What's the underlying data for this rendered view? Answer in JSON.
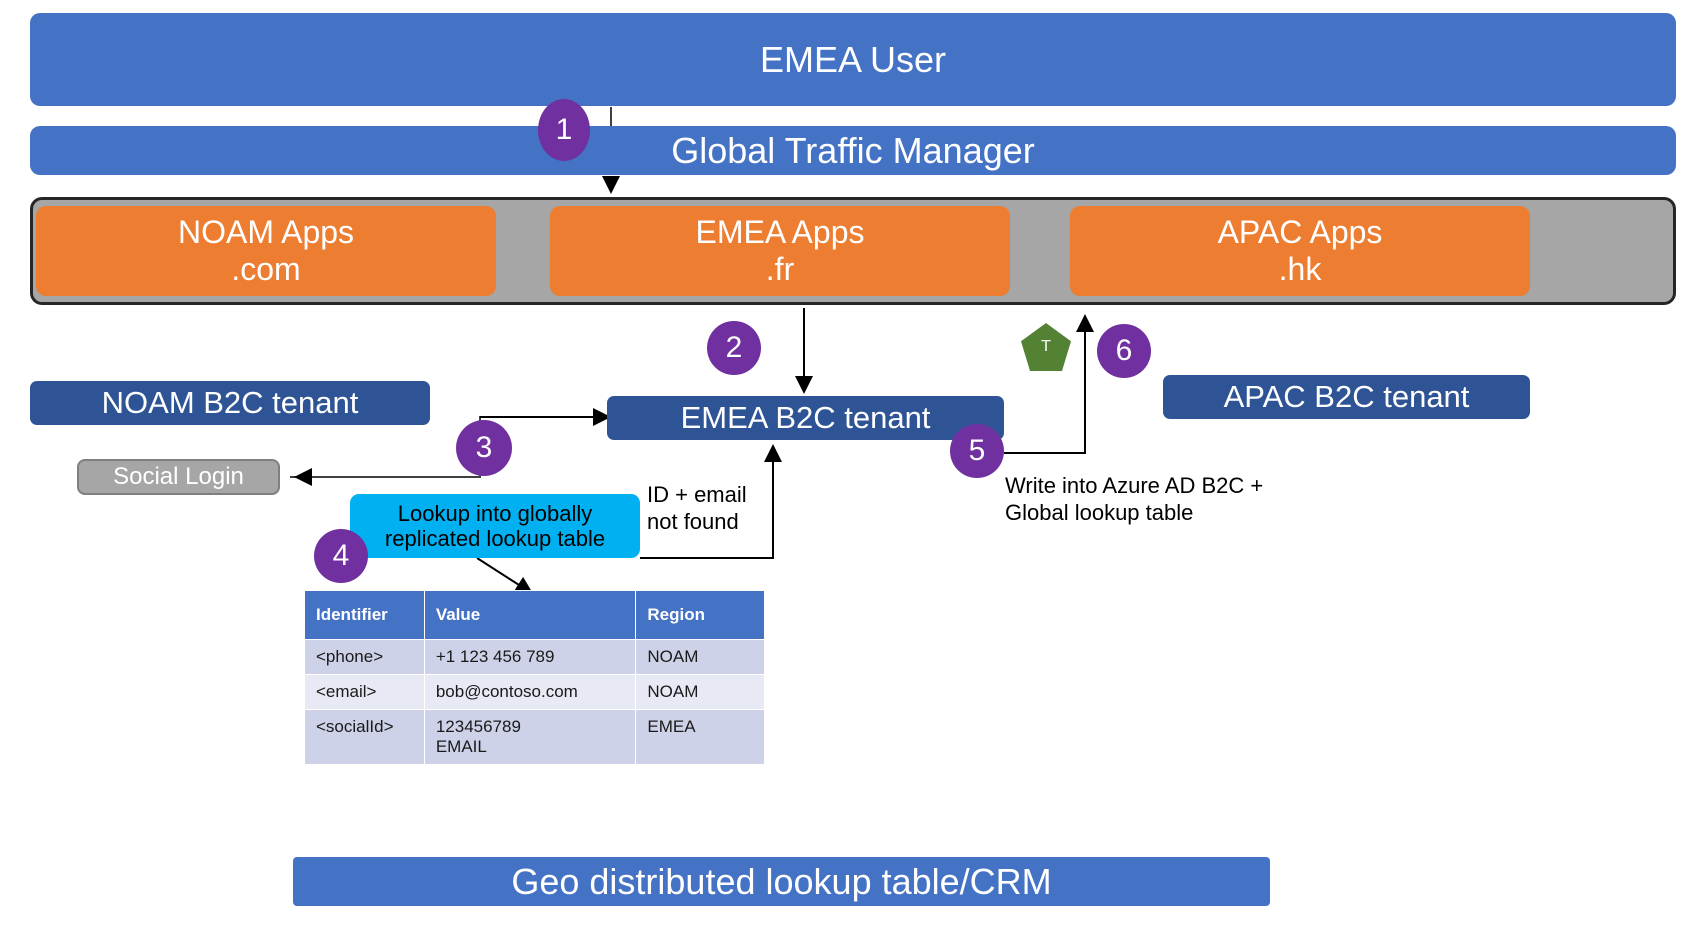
{
  "banners": {
    "emea_user": "EMEA User",
    "global_traffic_manager": "Global Traffic Manager",
    "crm": "Geo distributed lookup table/CRM"
  },
  "apps": [
    {
      "name": "NOAM Apps",
      "domain": ".com"
    },
    {
      "name": "EMEA Apps",
      "domain": ".fr"
    },
    {
      "name": "APAC Apps",
      "domain": ".hk"
    }
  ],
  "tenants": {
    "noam": "NOAM B2C tenant",
    "emea": "EMEA B2C tenant",
    "apac": "APAC B2C tenant"
  },
  "social_login": "Social Login",
  "lookup_callout": {
    "line1": "Lookup into globally",
    "line2": "replicated lookup table"
  },
  "annotations": {
    "not_found_line1": "ID + email",
    "not_found_line2": "not found",
    "write_line1": "Write into Azure AD B2C +",
    "write_line2": "Global lookup table"
  },
  "badges": {
    "one": "1",
    "two": "2",
    "three": "3",
    "four": "4",
    "five": "5",
    "six": "6"
  },
  "token": {
    "label": "T"
  },
  "lookup_table": {
    "headers": [
      "Identifier",
      "Value",
      "Region"
    ],
    "rows": [
      {
        "identifier": "<phone>",
        "value": "+1 123 456 789",
        "value2": "",
        "region": "NOAM"
      },
      {
        "identifier": "<email>",
        "value": "bob@contoso.com",
        "value2": "",
        "region": "NOAM"
      },
      {
        "identifier": "<socialId>",
        "value": "123456789",
        "value2": "EMAIL",
        "region": "EMEA"
      }
    ]
  },
  "colors": {
    "banner_blue": "#4472C4",
    "app_orange": "#ED7D31",
    "tenant_blue": "#2E5496",
    "badge_purple": "#7030A0",
    "callout_cyan": "#00B0F0",
    "token_green": "#548235",
    "container_gray": "#A6A6A6"
  }
}
